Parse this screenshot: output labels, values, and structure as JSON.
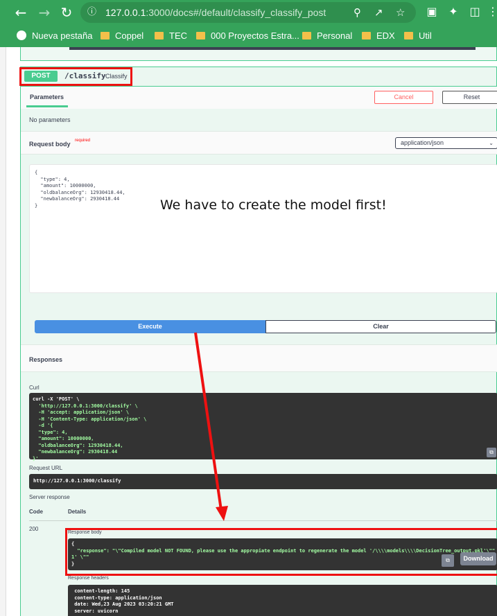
{
  "browser": {
    "url_host": "127.0.0.1",
    "url_rest": ":3000/docs#/default/classify_classify_post"
  },
  "bookmarks": [
    {
      "label": "Nueva pestaña",
      "icon": "globe-icon"
    },
    {
      "label": "Coppel",
      "icon": "folder-icon"
    },
    {
      "label": "TEC",
      "icon": "folder-icon"
    },
    {
      "label": "000 Proyectos Estra...",
      "icon": "folder-icon"
    },
    {
      "label": "Personal",
      "icon": "folder-icon"
    },
    {
      "label": "EDX",
      "icon": "folder-icon"
    },
    {
      "label": "Util",
      "icon": "folder-icon"
    }
  ],
  "operation": {
    "method": "POST",
    "path": "/classify",
    "description": "Classify"
  },
  "parameters": {
    "tab_label": "Parameters",
    "cancel_label": "Cancel",
    "reset_label": "Reset",
    "empty_text": "No parameters"
  },
  "request_body": {
    "label": "Request body",
    "required_label": "required",
    "content_type": "application/json",
    "lines": [
      "{",
      "  \"type\": 4,",
      "  \"amount\": 10000000,",
      "  \"oldbalanceOrg\": 12930418.44,",
      "  \"newbalanceOrg\": 2930418.44",
      "}"
    ],
    "annotation": "We have to create the model first!"
  },
  "actions": {
    "execute_label": "Execute",
    "clear_label": "Clear"
  },
  "responses": {
    "title": "Responses",
    "curl_label": "Curl",
    "curl_lines": [
      "curl -X 'POST' \\",
      "  'http://127.0.0.1:3000/classify' \\",
      "  -H 'accept: application/json' \\",
      "  -H 'Content-Type: application/json' \\",
      "  -d '{",
      "  \"type\": 4,",
      "  \"amount\": 10000000,",
      "  \"oldbalanceOrg\": 12930418.44,",
      "  \"newbalanceOrg\": 2930418.44",
      "}'"
    ],
    "request_url_label": "Request URL",
    "request_url": "http://127.0.0.1:3000/classify",
    "server_response_label": "Server response",
    "code_header": "Code",
    "details_header": "Details",
    "code": "200",
    "response_body_label": "Response body",
    "response_body_lines": [
      "{",
      "  \"response\": \"\\\"Compiled model NOT FOUND, please use the appropiate endpoint to regenerate the model '/\\\\\\\\models\\\\\\\\DecisionTree_output.pkl'\\\"\"",
      "1' \\\"\"",
      "}"
    ],
    "download_label": "Download",
    "response_headers_label": "Response headers",
    "headers_lines": [
      " content-length: 145",
      " content-type: application/json",
      " date: Wed,23 Aug 2023 03:20:21 GMT",
      " server: uvicorn"
    ]
  },
  "colors": {
    "chrome": "#35a35a",
    "post_green": "#49cc90",
    "execute_blue": "#4990e2",
    "annotation_red": "#ee1111"
  }
}
